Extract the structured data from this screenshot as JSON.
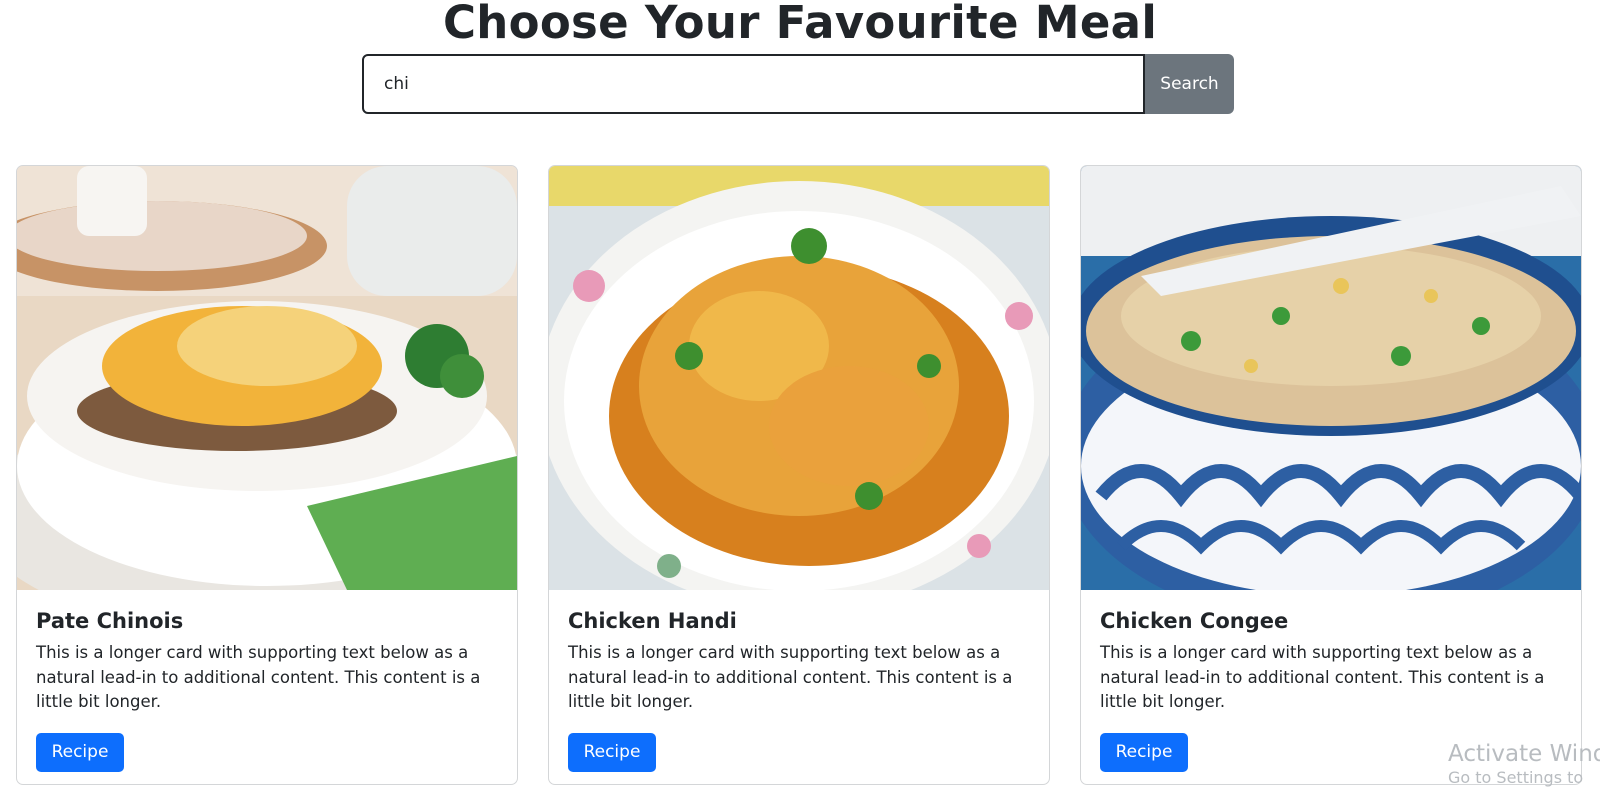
{
  "header": {
    "title": "Choose Your Favourite Meal"
  },
  "search": {
    "value": "chi",
    "button_label": "Search"
  },
  "cards": [
    {
      "title": "Pate Chinois",
      "text": "This is a longer card with supporting text below as a natural lead-in to additional content. This content is a little bit longer.",
      "button_label": "Recipe"
    },
    {
      "title": "Chicken Handi",
      "text": "This is a longer card with supporting text below as a natural lead-in to additional content. This content is a little bit longer.",
      "button_label": "Recipe"
    },
    {
      "title": "Chicken Congee",
      "text": "This is a longer card with supporting text below as a natural lead-in to additional content. This content is a little bit longer.",
      "button_label": "Recipe"
    }
  ],
  "watermark": {
    "title": "Activate Wind",
    "subtitle": "Go to Settings to"
  },
  "colors": {
    "primary": "#0d6efd",
    "secondary": "#6c757d",
    "text": "#212529"
  }
}
